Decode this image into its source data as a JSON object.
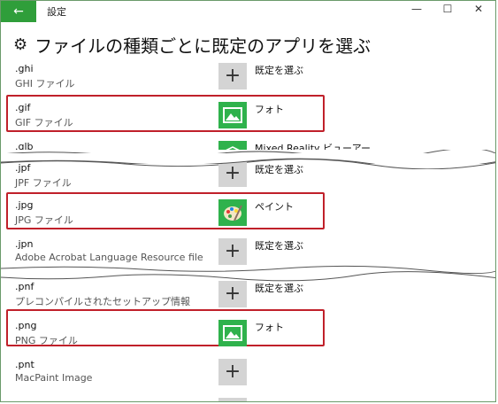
{
  "window": {
    "back_label": "←",
    "title": "設定",
    "minimize": "—",
    "maximize": "☐",
    "close": "✕"
  },
  "header": {
    "icon": "gear-icon",
    "title": "ファイルの種類ごとに既定のアプリを選ぶ"
  },
  "rows": [
    {
      "ext": ".ghi",
      "desc": "GHI ファイル",
      "app": "既定を選ぶ",
      "icon": "plus"
    },
    {
      "ext": ".gif",
      "desc": "GIF ファイル",
      "app": "フォト",
      "icon": "photos"
    },
    {
      "ext": ".glb",
      "desc": "",
      "app": "Mixed Reality ビューアー",
      "icon": "mixed-reality"
    },
    {
      "ext": ".jpf",
      "desc": "JPF ファイル",
      "app": "既定を選ぶ",
      "icon": "plus"
    },
    {
      "ext": ".jpg",
      "desc": "JPG ファイル",
      "app": "ペイント",
      "icon": "paint"
    },
    {
      "ext": ".jpn",
      "desc": "Adobe Acrobat Language Resource file",
      "app": "既定を選ぶ",
      "icon": "plus"
    },
    {
      "ext": ".pnf",
      "desc": "プレコンパイルされたセットアップ情報",
      "app": "既定を選ぶ",
      "icon": "plus"
    },
    {
      "ext": ".png",
      "desc": "PNG ファイル",
      "app": "フォト",
      "icon": "photos"
    },
    {
      "ext": ".pnt",
      "desc": "MacPaint Image",
      "app": "",
      "icon": "plus"
    }
  ],
  "plus_glyph": "+",
  "colors": {
    "accent_green": "#2f9e3a",
    "app_tile_green": "#2fb24c",
    "highlight_red": "#c0202a",
    "plus_tile": "#d4d4d4"
  }
}
